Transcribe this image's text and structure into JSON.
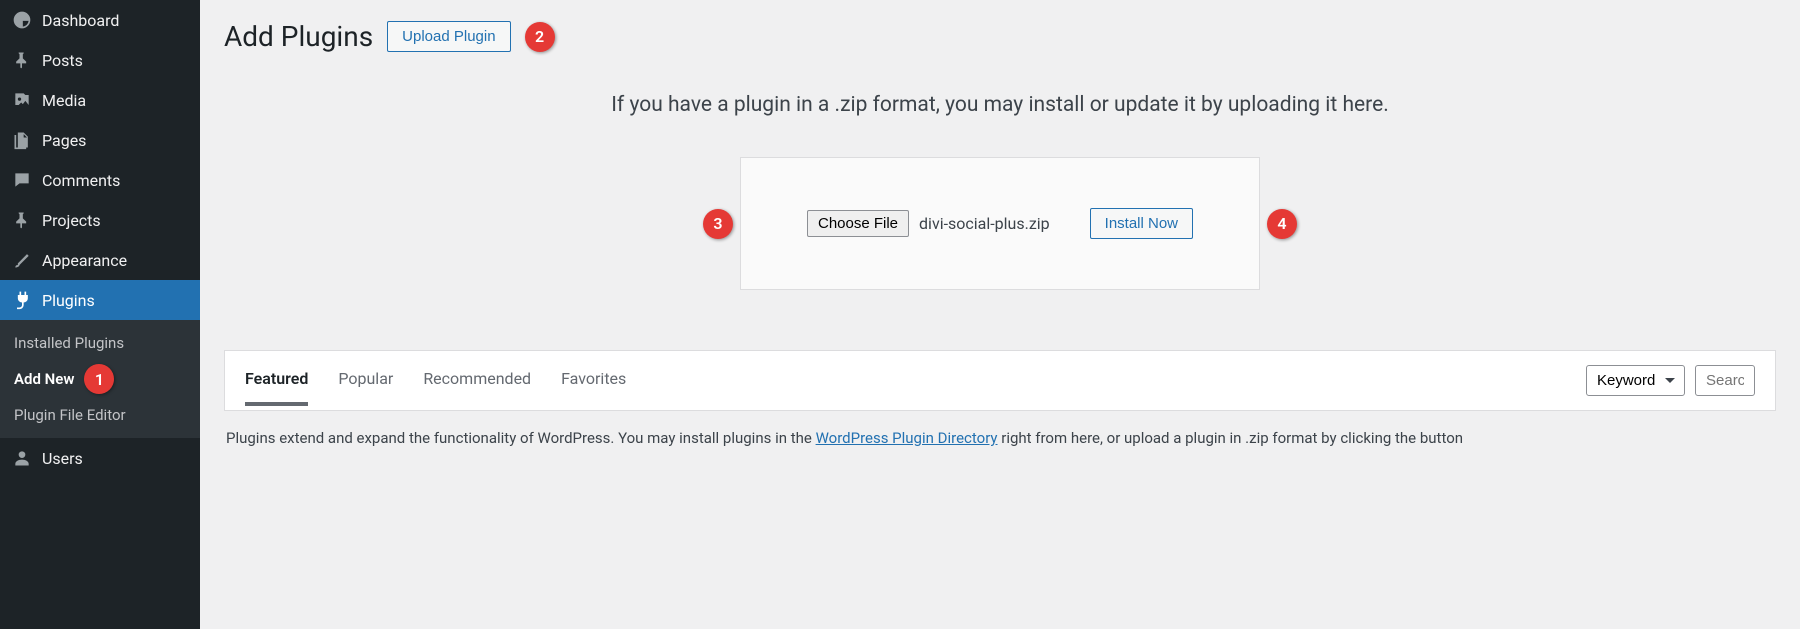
{
  "sidebar": {
    "items": [
      {
        "label": "Dashboard",
        "icon": "dashboard"
      },
      {
        "label": "Posts",
        "icon": "pin"
      },
      {
        "label": "Media",
        "icon": "media"
      },
      {
        "label": "Pages",
        "icon": "pages"
      },
      {
        "label": "Comments",
        "icon": "comment"
      },
      {
        "label": "Projects",
        "icon": "pin"
      },
      {
        "label": "Appearance",
        "icon": "brush"
      },
      {
        "label": "Plugins",
        "icon": "plug",
        "active": true
      },
      {
        "label": "Users",
        "icon": "user"
      }
    ],
    "submenu": [
      {
        "label": "Installed Plugins"
      },
      {
        "label": "Add New",
        "bold": true
      },
      {
        "label": "Plugin File Editor"
      }
    ]
  },
  "header": {
    "title": "Add Plugins",
    "upload_button": "Upload Plugin"
  },
  "upload": {
    "instruction": "If you have a plugin in a .zip format, you may install or update it by uploading it here.",
    "choose_file_label": "Choose File",
    "file_name": "divi-social-plus.zip",
    "install_label": "Install Now"
  },
  "filter": {
    "tabs": [
      "Featured",
      "Popular",
      "Recommended",
      "Favorites"
    ],
    "active_tab": "Featured",
    "keyword_label": "Keyword",
    "search_placeholder": "Search"
  },
  "description": {
    "pre": "Plugins extend and expand the functionality of WordPress. You may install plugins in the ",
    "link": "WordPress Plugin Directory",
    "post": " right from here, or upload a plugin in .zip format by clicking the button"
  },
  "annotations": {
    "b1": "1",
    "b2": "2",
    "b3": "3",
    "b4": "4"
  }
}
